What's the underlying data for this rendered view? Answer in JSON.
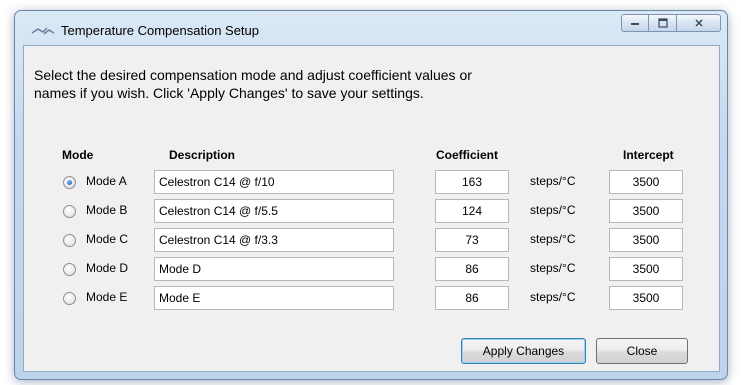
{
  "window": {
    "title": "Temperature Compensation Setup",
    "icon": "temperature-app-icon",
    "controls": [
      "minimize-icon",
      "maximize-icon",
      "close-icon"
    ]
  },
  "instructions": {
    "line1": "Select the desired compensation mode and adjust coefficient values or",
    "line2": "names if you wish. Click 'Apply Changes' to save your settings."
  },
  "headers": {
    "mode": "Mode",
    "description": "Description",
    "coefficient": "Coefficient",
    "intercept": "Intercept"
  },
  "rows": [
    {
      "mode": "Mode A",
      "selected": true,
      "description": "Celestron C14 @ f/10",
      "coefficient": "163",
      "unit": "steps/°C",
      "intercept": "3500"
    },
    {
      "mode": "Mode B",
      "selected": false,
      "description": "Celestron C14 @ f/5.5",
      "coefficient": "124",
      "unit": "steps/°C",
      "intercept": "3500"
    },
    {
      "mode": "Mode C",
      "selected": false,
      "description": "Celestron C14 @ f/3.3",
      "coefficient": "73",
      "unit": "steps/°C",
      "intercept": "3500"
    },
    {
      "mode": "Mode D",
      "selected": false,
      "description": "Mode D",
      "coefficient": "86",
      "unit": "steps/°C",
      "intercept": "3500"
    },
    {
      "mode": "Mode E",
      "selected": false,
      "description": "Mode E",
      "coefficient": "86",
      "unit": "steps/°C",
      "intercept": "3500"
    }
  ],
  "buttons": {
    "apply": "Apply Changes",
    "close": "Close"
  }
}
